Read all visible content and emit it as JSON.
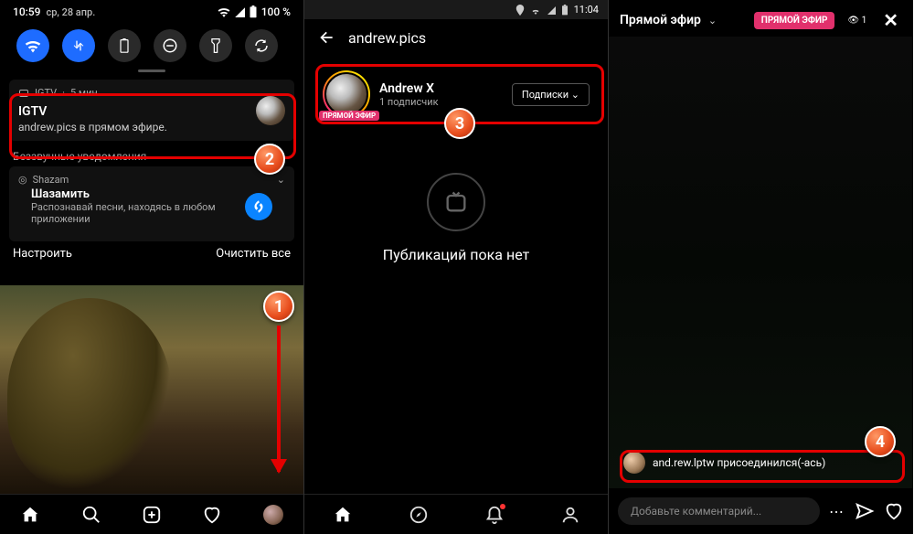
{
  "phone1": {
    "status": {
      "time": "10:59",
      "date": "ср, 28 апр.",
      "battery": "100 %"
    },
    "notification": {
      "app": "IGTV",
      "age": "5 мин.",
      "title": "IGTV",
      "body": "andrew.pics в прямом эфире."
    },
    "silent_label": "Беззвучные уведомления",
    "shazam": {
      "app": "Shazam",
      "title": "Шазамить",
      "sub": "Распознавай песни, находясь в любом приложении"
    },
    "actions": {
      "customize": "Настроить",
      "clear": "Очистить все"
    }
  },
  "phone2": {
    "status_time": "11:04",
    "username": "andrew.pics",
    "profile": {
      "name": "Andrew X",
      "subscribers": "1 подписчик",
      "live_tag": "ПРЯМОЙ ЭФИР",
      "follow_btn": "Подписки"
    },
    "empty": "Публикаций пока нет"
  },
  "phone3": {
    "title": "Прямой эфир",
    "live_badge": "ПРЯМОЙ ЭФИР",
    "viewers": "1",
    "joined_user": "and.rew.lptw",
    "joined_suffix": "присоединился(-ась)",
    "comment_placeholder": "Добавьте комментарий..."
  },
  "annotations": {
    "n1": "1",
    "n2": "2",
    "n3": "3",
    "n4": "4"
  }
}
